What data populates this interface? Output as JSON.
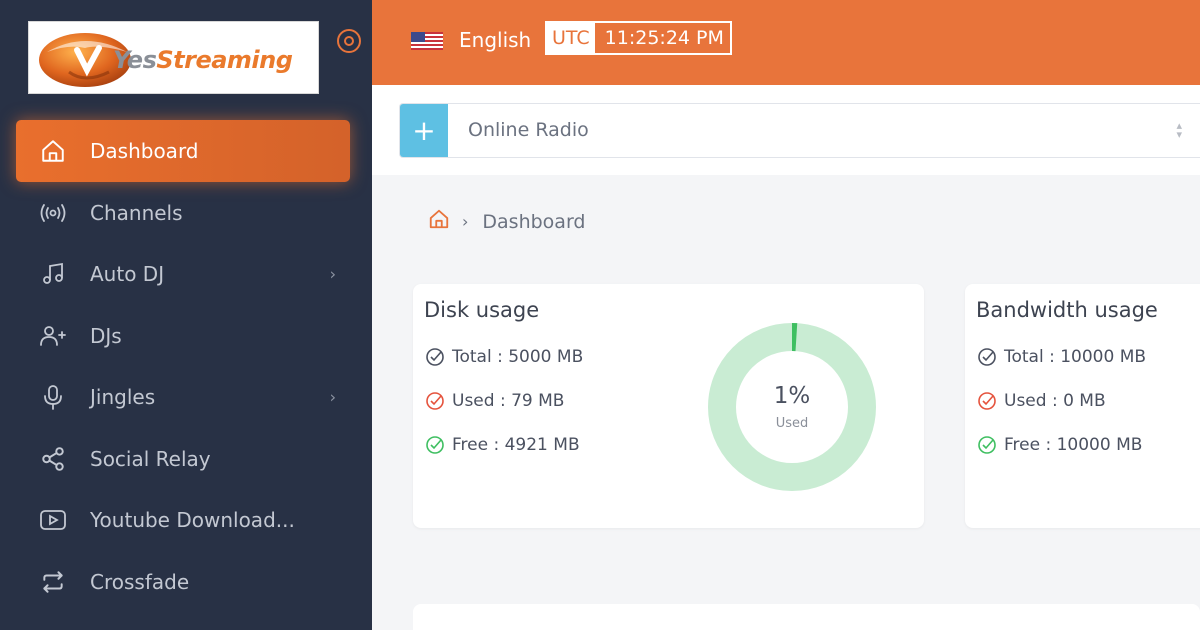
{
  "brand": {
    "logo_yes": "Yes",
    "logo_streaming": "Streaming"
  },
  "sidebar": {
    "items": [
      {
        "label": "Dashboard",
        "icon": "home-icon",
        "active": true
      },
      {
        "label": "Channels",
        "icon": "broadcast-icon"
      },
      {
        "label": "Auto DJ",
        "icon": "music-icon",
        "has_submenu": true
      },
      {
        "label": "DJs",
        "icon": "user-plus-icon"
      },
      {
        "label": "Jingles",
        "icon": "microphone-icon",
        "has_submenu": true
      },
      {
        "label": "Social Relay",
        "icon": "share-icon"
      },
      {
        "label": "Youtube Download...",
        "icon": "youtube-icon"
      },
      {
        "label": "Crossfade",
        "icon": "repeat-icon"
      }
    ]
  },
  "topbar": {
    "language": "English",
    "timezone": "UTC",
    "time": "11:25:24 PM"
  },
  "channel_select": {
    "value": "Online Radio",
    "add_label": "+"
  },
  "breadcrumb": {
    "current": "Dashboard"
  },
  "disk_usage": {
    "title": "Disk usage",
    "total": "Total : 5000 MB",
    "used": "Used : 79 MB",
    "free": "Free : 4921 MB",
    "percent_label": "1%",
    "percent_value": 1,
    "used_caption": "Used"
  },
  "bandwidth_usage": {
    "title": "Bandwidth usage",
    "total": "Total : 10000 MB",
    "used": "Used : 0 MB",
    "free": "Free : 10000 MB"
  },
  "colors": {
    "accent": "#e8743b",
    "sidebar_bg": "#283145",
    "donut_track": "#c9ecd3",
    "donut_fill": "#3fbf61",
    "ok_green": "#3fbf61",
    "warn_red": "#e5533d"
  }
}
